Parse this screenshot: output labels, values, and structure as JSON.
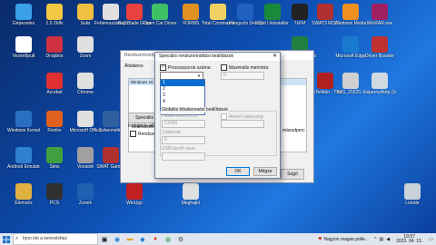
{
  "desktop_icons": [
    {
      "label": "Gépezetes",
      "color": "#3aa0e8"
    },
    {
      "label": "1.0 Zkflv",
      "color": "#f2c744"
    },
    {
      "label": "Sulis",
      "color": "#f0c040"
    },
    {
      "label": "Fehéreszúrós Zeny",
      "color": "#e0e0e0"
    },
    {
      "label": "Bay Blade Gumn",
      "color": "#e94040"
    },
    {
      "label": "Open Car Driver",
      "color": "#3fbf66"
    },
    {
      "label": "VORMS",
      "color": "#e09020"
    },
    {
      "label": "Total Commander",
      "color": "#f0d060"
    },
    {
      "label": "Hangszín Debug",
      "color": "#2060c0"
    },
    {
      "label": "IObit Uninstaller",
      "color": "#1a8a3a"
    },
    {
      "label": "7zFM",
      "color": "#222222"
    },
    {
      "label": "SWAT3 MOD",
      "color": "#b03030"
    },
    {
      "label": "Windows Media Player",
      "color": "#f09020"
    },
    {
      "label": "WinRAR.exe",
      "color": "#a02060"
    },
    {
      "label": "Vezérlőpult",
      "color": "#ffffff"
    },
    {
      "label": "Dropbox",
      "color": "#d03040"
    },
    {
      "label": "Zoom",
      "color": "#e0e0e0"
    },
    {
      "label": "Microsoft Edge",
      "color": "#1a7ad0"
    },
    {
      "label": "Driver Booster",
      "color": "#c03030"
    },
    {
      "label": "Real Time Sentinel",
      "color": "#208040"
    },
    {
      "label": "Acrobat",
      "color": "#e03030"
    },
    {
      "label": "Chrome",
      "color": "#e0e0e0"
    },
    {
      "label": "SWAT3",
      "color": "#303030"
    },
    {
      "label": "dmTerlitén - The New Or...",
      "color": "#b02020"
    },
    {
      "label": "IMG_20220...",
      "color": "#d0d0d0"
    },
    {
      "label": "Képernyőkép (160).png",
      "color": "#d0d8e0"
    },
    {
      "label": "Windows Kernel",
      "color": "#2a70c0"
    },
    {
      "label": "Firefox",
      "color": "#e06020"
    },
    {
      "label": "Microsoft Office",
      "color": "#e0e0e0"
    },
    {
      "label": "Szkennelés",
      "color": "#3060a0"
    },
    {
      "label": "Android Emulator",
      "color": "#3080d0"
    },
    {
      "label": "Sims",
      "color": "#40a040"
    },
    {
      "label": "Vonatok",
      "color": "#a0a0a0"
    },
    {
      "label": "SWAT Games",
      "color": "#b03030"
    },
    {
      "label": "Elemzés",
      "color": "#e0b040"
    },
    {
      "label": "PCS",
      "color": "#303030"
    },
    {
      "label": "Zenek",
      "color": "#2060b0"
    },
    {
      "label": "WinUpp",
      "color": "#c02020"
    },
    {
      "label": "Meghajtó",
      "color": "#e0e0e0"
    },
    {
      "label": "Lomtár",
      "color": "#c8d0d8"
    }
  ],
  "bg_window": {
    "title": "Rendszerkonfiguráció",
    "tab": "Általános",
    "list_item": "Windows 10 (C:\\Windows) : Aktuális operációs rendszer; Alapértelmezett OS",
    "advanced_button": "Speciális beállítások...",
    "boot_options_label": "Indítási beállítások",
    "safe_boot_label": "Rendszerindítás csökkentett módban",
    "timeout_suffix": "másodperc",
    "apply_label": "Súgó"
  },
  "dialog": {
    "title": "Speciális rendszerindítási beállítások",
    "close_glyph": "✕",
    "cpu_count_label": "Processzorok száma:",
    "cpu_checked": "✓",
    "cpu_options": [
      "1",
      "2",
      "3",
      "4"
    ],
    "cpu_selected_index": 0,
    "max_memory_label": "Maximális memória:",
    "max_memory_value": "0",
    "global_debug_label": "Globális hibakeresési beállítások",
    "debug_checkbox_label": "Hibakeresés",
    "debug_port_label": "Hibakeresési port:",
    "debug_port_value": "COM1",
    "baud_label": "Átviteli sebesség:",
    "channel_label": "Csatorna:",
    "channel_value": "0",
    "usb_target_label": "USB-tárolő neve:",
    "ok_label": "OK",
    "cancel_label": "Mégse"
  },
  "taskbar": {
    "search_placeholder": "Írjon ide a kereséshez",
    "notification": "Nagyon magas polle...",
    "time": "19:57",
    "date": "2023. 04. 15."
  }
}
